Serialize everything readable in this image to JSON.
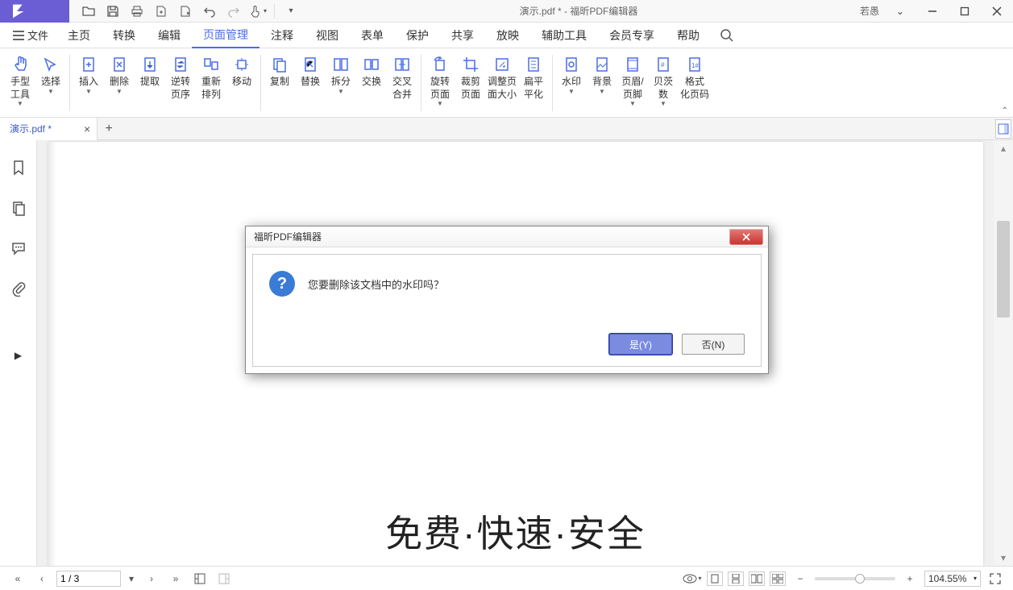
{
  "app": {
    "doc_title_full": "演示.pdf * - 福昕PDF编辑器",
    "user_name": "若愚"
  },
  "qa": {
    "open": "open-icon",
    "save": "save-icon",
    "print": "print-icon",
    "fileA": "file-a-icon",
    "fileB": "file-b-icon",
    "undo": "undo-icon",
    "redo": "redo-icon",
    "hand": "hand-icon",
    "custom": "custom-icon"
  },
  "menu": {
    "file": "文件",
    "items": [
      {
        "k": "home",
        "l": "主页"
      },
      {
        "k": "convert",
        "l": "转换"
      },
      {
        "k": "edit",
        "l": "编辑"
      },
      {
        "k": "pagemgmt",
        "l": "页面管理",
        "active": true
      },
      {
        "k": "annotate",
        "l": "注释"
      },
      {
        "k": "view",
        "l": "视图"
      },
      {
        "k": "form",
        "l": "表单"
      },
      {
        "k": "protect",
        "l": "保护"
      },
      {
        "k": "share",
        "l": "共享"
      },
      {
        "k": "play",
        "l": "放映"
      },
      {
        "k": "assist",
        "l": "辅助工具"
      },
      {
        "k": "member",
        "l": "会员专享"
      },
      {
        "k": "help",
        "l": "帮助"
      }
    ]
  },
  "ribbon": [
    {
      "k": "hand",
      "l": "手型\n工具",
      "dd": true
    },
    {
      "k": "select",
      "l": "选择",
      "dd": true
    },
    {
      "sep": true
    },
    {
      "k": "insert",
      "l": "插入",
      "dd": true
    },
    {
      "k": "delete",
      "l": "删除",
      "dd": true
    },
    {
      "k": "extract",
      "l": "提取"
    },
    {
      "k": "reverse",
      "l": "逆转\n页序"
    },
    {
      "k": "rearr",
      "l": "重新\n排列"
    },
    {
      "k": "move",
      "l": "移动"
    },
    {
      "sep": true
    },
    {
      "k": "copy",
      "l": "复制"
    },
    {
      "k": "replace",
      "l": "替换"
    },
    {
      "k": "split",
      "l": "拆分",
      "dd": true
    },
    {
      "k": "swap",
      "l": "交换"
    },
    {
      "k": "xmerge",
      "l": "交叉\n合并"
    },
    {
      "sep": true
    },
    {
      "k": "rotate",
      "l": "旋转\n页面",
      "dd": true
    },
    {
      "k": "crop",
      "l": "裁剪\n页面"
    },
    {
      "k": "resize",
      "l": "调整页\n面大小"
    },
    {
      "k": "flatten",
      "l": "扁平\n平化"
    },
    {
      "sep": true
    },
    {
      "k": "watermark",
      "l": "水印",
      "dd": true
    },
    {
      "k": "background",
      "l": "背景",
      "dd": true
    },
    {
      "k": "headerfooter",
      "l": "页眉/\n页脚",
      "dd": true
    },
    {
      "k": "bates",
      "l": "贝茨\n数",
      "dd": true
    },
    {
      "k": "fmtpage",
      "l": "格式\n化页码"
    }
  ],
  "tab": {
    "name": "演示.pdf *"
  },
  "page": {
    "big_text": "免费·快速·安全"
  },
  "status": {
    "page_indicator": "1 / 3",
    "zoom": "104.55%"
  },
  "dialog": {
    "title": "福昕PDF编辑器",
    "message": "您要删除该文档中的水印吗？",
    "yes": "是(Y)",
    "no": "否(N)"
  }
}
